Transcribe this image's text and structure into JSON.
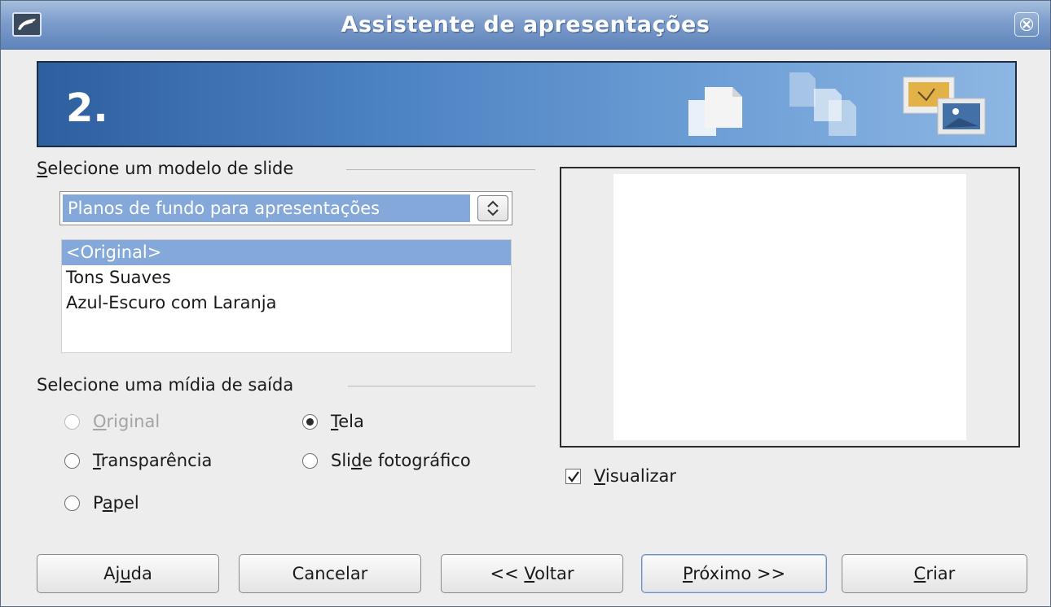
{
  "window": {
    "title": "Assistente de apresentações",
    "app_icon": "app-icon",
    "close_icon": "close-icon"
  },
  "banner": {
    "step": "2.",
    "icons": [
      "pages-icon",
      "documents-icon",
      "images-icon"
    ],
    "gradient_colors": [
      "#2e5f9f",
      "#8db6e3"
    ]
  },
  "slide_model": {
    "section_label_prefix": "S",
    "section_label_rest": "elecione um modelo de slide",
    "category": "Planos de fundo para apresentações",
    "items": [
      "<Original>",
      "Tons Suaves",
      "Azul-Escuro com Laranja"
    ],
    "selected_index": 0
  },
  "output_media": {
    "section_label": "Selecione uma mídia de saída",
    "options": [
      {
        "pre": "",
        "key": "O",
        "post": "riginal",
        "checked": false,
        "disabled": true
      },
      {
        "pre": "",
        "key": "T",
        "post": "ela",
        "checked": true,
        "disabled": false
      },
      {
        "pre": "",
        "key": "T",
        "post": "ransparência",
        "checked": false,
        "disabled": false
      },
      {
        "pre": "Sli",
        "key": "d",
        "post": "e fotográfico",
        "checked": false,
        "disabled": false
      },
      {
        "pre": "P",
        "key": "a",
        "post": "pel",
        "checked": false,
        "disabled": false
      }
    ]
  },
  "preview": {
    "checkbox_key": "V",
    "checkbox_rest": "isualizar",
    "checked": true
  },
  "buttons": {
    "help": {
      "pre": "Aj",
      "key": "u",
      "post": "da"
    },
    "cancel": {
      "label": "Cancelar"
    },
    "back": {
      "pre": "<< ",
      "key": "V",
      "post": "oltar"
    },
    "next": {
      "pre": "",
      "key": "P",
      "post": "róximo >>"
    },
    "create": {
      "pre": "",
      "key": "C",
      "post": "riar"
    }
  },
  "colors": {
    "selection": "#84a8d9",
    "titlebar": "#7c9ccb",
    "default_button_border": "#6d8fbf"
  }
}
